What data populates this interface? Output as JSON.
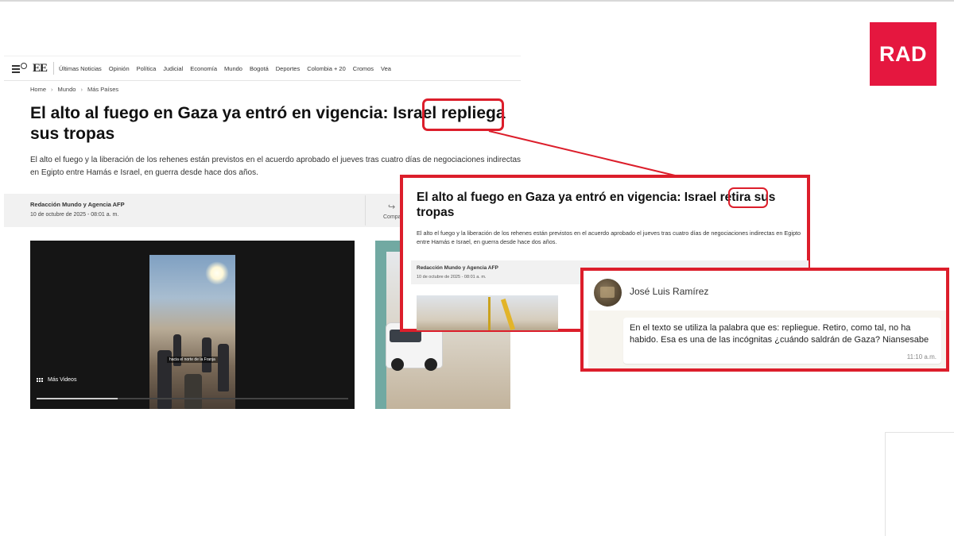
{
  "brand": {
    "logo_text": "RAD",
    "logo_color": "#e5173f",
    "highlight_color": "#dc1e2b"
  },
  "article": {
    "site_logo": "EE",
    "nav_items": [
      "Últimas Noticias",
      "Opinión",
      "Política",
      "Judicial",
      "Economía",
      "Mundo",
      "Bogotá",
      "Deportes",
      "Colombia + 20",
      "Cromos",
      "Vea"
    ],
    "breadcrumb": [
      "Home",
      "Mundo",
      "Más Países"
    ],
    "headline": "El alto al fuego en Gaza ya entró en vigencia: Israel repliega sus tropas",
    "subtitle": "El alto el fuego y la liberación de los rehenes están previstos en el acuerdo aprobado el jueves tras cuatro días de negociaciones indirectas en Egipto entre Hamás e Israel, en guerra desde hace dos años.",
    "author": "Redacción Mundo y Agencia AFP",
    "date": "10 de octubre de 2025 - 08:01 a. m.",
    "share_label": "Compa",
    "video": {
      "caption": "hacia el norte de la Franja",
      "more_videos_label": "Más Videos",
      "progress": 0.26
    }
  },
  "zoom": {
    "headline": "El alto al fuego en Gaza ya entró en vigencia: Israel retira sus tropas",
    "subtitle": "El alto el fuego y la liberación de los rehenes están previstos en el acuerdo aprobado el jueves tras cuatro días de negociaciones indirectas en Egipto entre Hamás e Israel, en guerra desde hace dos años.",
    "author": "Redacción Mundo y Agencia AFP",
    "date": "10 de octubre de 2025 - 08:01 a. m."
  },
  "comment": {
    "name": "José Luis Ramírez",
    "text": "En el texto se utiliza la palabra que es: repliegue. Retiro, como tal, no ha habido. Esa es una de las incógnitas ¿cuándo saldrán de Gaza? Niansesabe",
    "time": "11:10 a.m."
  }
}
